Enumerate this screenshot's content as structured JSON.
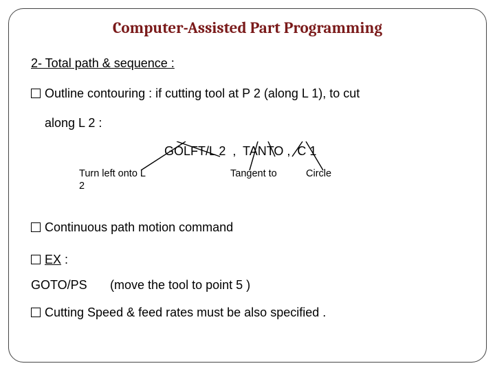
{
  "title": "Computer-Assisted Part Programming",
  "section_heading": "2- Total path & sequence :",
  "bullet_outline_pre": "Outline contouring : if cutting tool at P 2 (along L 1), to cut",
  "bullet_outline_cont": "along L 2 :",
  "code_line": "GOLFT/L 2  ,  TANTO ,  C 1",
  "annot": {
    "turn_left": "Turn left onto L 2",
    "tangent": "Tangent to",
    "circle": "Circle"
  },
  "bullet_continuous": "Continuous path motion command",
  "ex_label": "EX",
  "ex_colon": " :",
  "goto_cmd": "GOTO/PS",
  "goto_desc": "(move the tool to point 5 )",
  "bullet_cutting": "Cutting Speed & feed rates must be also specified ."
}
